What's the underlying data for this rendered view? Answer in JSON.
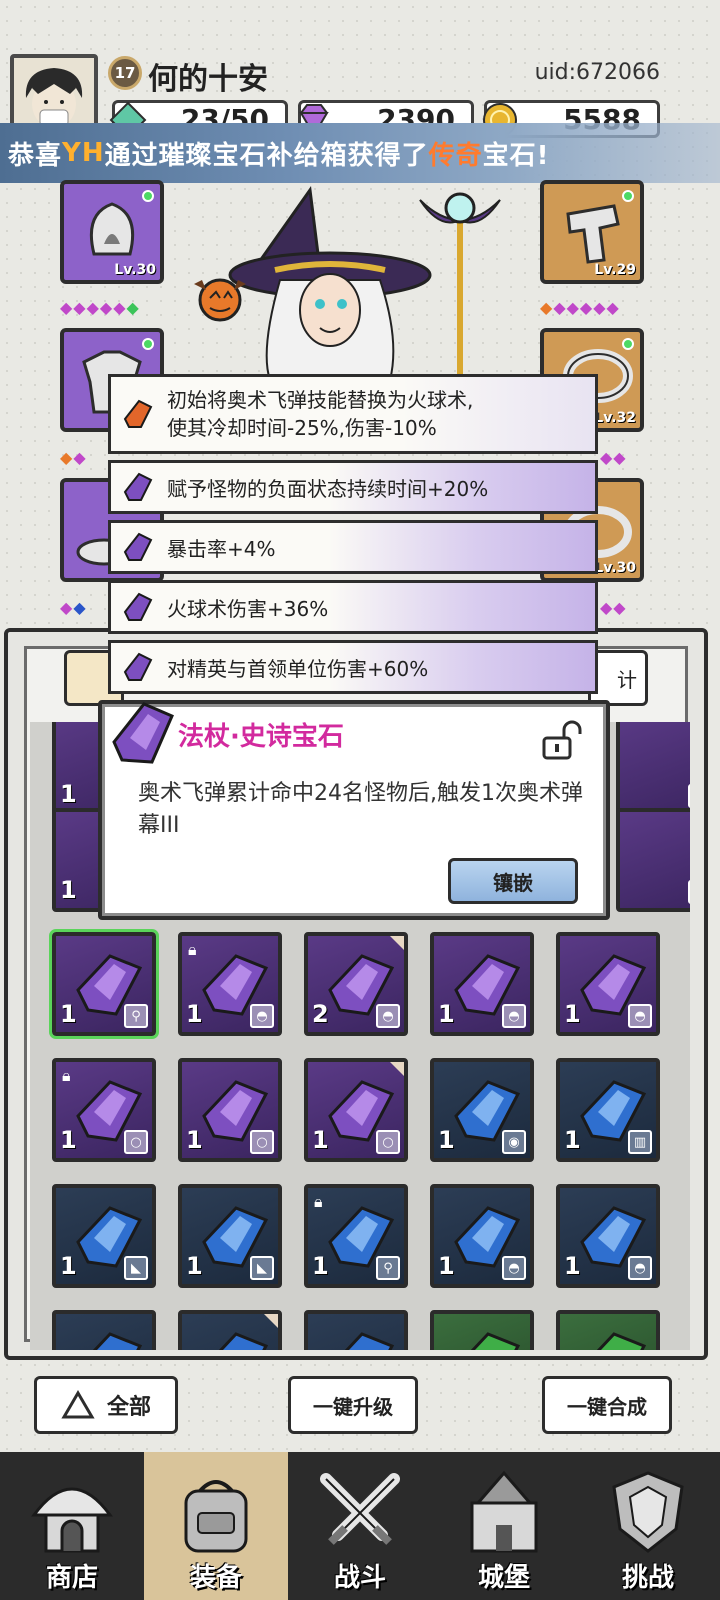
{
  "player": {
    "level": "17",
    "name": "何的十安",
    "uid": "uid:672066"
  },
  "resources": {
    "energy": "23/50",
    "gems": "2390",
    "gold": "5588"
  },
  "ticker": {
    "prefix": "恭喜",
    "player": "YH",
    "middle": "通过璀璨宝石补给箱获得了",
    "rarity": "传奇",
    "suffix": "宝石!"
  },
  "equipment": {
    "left_top_level": "Lv.30",
    "right_top_level": "Lv.29",
    "right_mid_level": "Lv.32",
    "right_bottom_level": "Lv.30"
  },
  "affixes": [
    {
      "text1": "初始将奥术飞弹技能替换为火球术,",
      "text2": "使其冷却时间-25%,伤害-10%"
    },
    {
      "text1": "赋予怪物的负面状态持续时间+20%"
    },
    {
      "text1": "暴击率+4%"
    },
    {
      "text1": "火球术伤害+36%"
    },
    {
      "text1": "对精英与首领单位伤害+60%"
    }
  ],
  "popup": {
    "title": "法杖·史诗宝石",
    "desc": "奥术飞弹累计命中24名怪物后,触发1次奥术弹幕III",
    "inlay_label": "镶嵌"
  },
  "panel": {
    "right_tab_partial": "计"
  },
  "grid": {
    "row1_counts": [
      "1",
      "1",
      "2",
      "1",
      "1"
    ],
    "row2_counts": [
      "1",
      "1",
      "1",
      "1",
      "1"
    ],
    "row3_counts": [
      "1",
      "1",
      "1",
      "1",
      "1"
    ],
    "hidden_left_counts": [
      "1",
      "1"
    ]
  },
  "actions": {
    "all": "全部",
    "upgrade": "一键升级",
    "merge": "一键合成"
  },
  "nav": [
    {
      "label": "商店"
    },
    {
      "label": "装备"
    },
    {
      "label": "战斗"
    },
    {
      "label": "城堡"
    },
    {
      "label": "挑战"
    }
  ],
  "colors": {
    "epic": "#8d62c9",
    "legend": "#cf9a55",
    "accent_pink": "#d22a9e",
    "ticker_highlight": "#ffb02e"
  }
}
